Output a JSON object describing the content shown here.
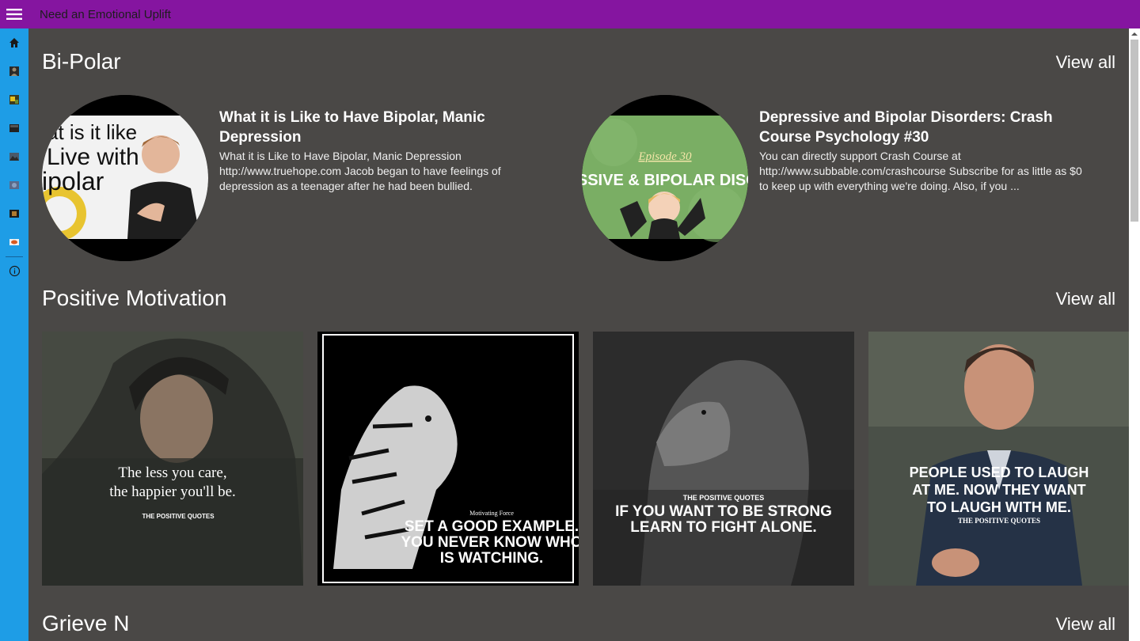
{
  "app": {
    "title": "Need an Emotional Uplift"
  },
  "sidebar": {
    "items": [
      {
        "icon": "home-icon"
      },
      {
        "icon": "person-icon"
      },
      {
        "icon": "photo-icon"
      },
      {
        "icon": "video-icon"
      },
      {
        "icon": "landscape-icon"
      },
      {
        "icon": "globe-icon"
      },
      {
        "icon": "film-icon"
      },
      {
        "icon": "food-icon"
      }
    ],
    "info_icon": "info-icon"
  },
  "sections": {
    "bipolar": {
      "title": "Bi-Polar",
      "view_all": "View all",
      "videos": [
        {
          "title": "What it is Like to Have Bipolar, Manic Depression",
          "description": "What it is Like to Have Bipolar, Manic Depression http://www.truehope.com Jacob began to have feelings of depression as a teenager after he had been bullied.",
          "thumb_text_1": "at is it like",
          "thumb_text_2": "Live with",
          "thumb_text_3": "ipolar"
        },
        {
          "title": "Depressive and Bipolar Disorders: Crash Course Psychology #30",
          "description": "You can directly support Crash Course at http://www.subbable.com/crashcourse Subscribe for as little as $0 to keep up with everything we're doing. Also, if you ...",
          "thumb_text_1": "Episode 30",
          "thumb_text_2": "PRESSIVE & BIPOLAR DISORDI"
        }
      ]
    },
    "motivation": {
      "title": "Positive Motivation",
      "view_all": "View all",
      "tiles": [
        {
          "quote_1": "The less you care,",
          "quote_2": "the happier you'll be.",
          "credit": "THE POSITIVE QUOTES"
        },
        {
          "kicker": "Motivating Force",
          "quote_1": "SET A GOOD EXAMPLE.",
          "quote_2": "YOU NEVER KNOW WHO",
          "quote_3": "IS WATCHING."
        },
        {
          "kicker": "THE POSITIVE QUOTES",
          "quote_1": "IF YOU WANT TO BE STRONG",
          "quote_2": "LEARN TO FIGHT ALONE."
        },
        {
          "quote_1": "PEOPLE USED TO LAUGH",
          "quote_2": "AT ME. NOW THEY WANT",
          "quote_3": "TO LAUGH WITH ME.",
          "credit": "THE POSITIVE QUOTES"
        }
      ]
    },
    "grieve": {
      "title": "Grieve N",
      "view_all": "View all"
    }
  },
  "colors": {
    "titlebar": "#8515a0",
    "sidebar": "#1e9de6",
    "background": "#4a4846"
  }
}
